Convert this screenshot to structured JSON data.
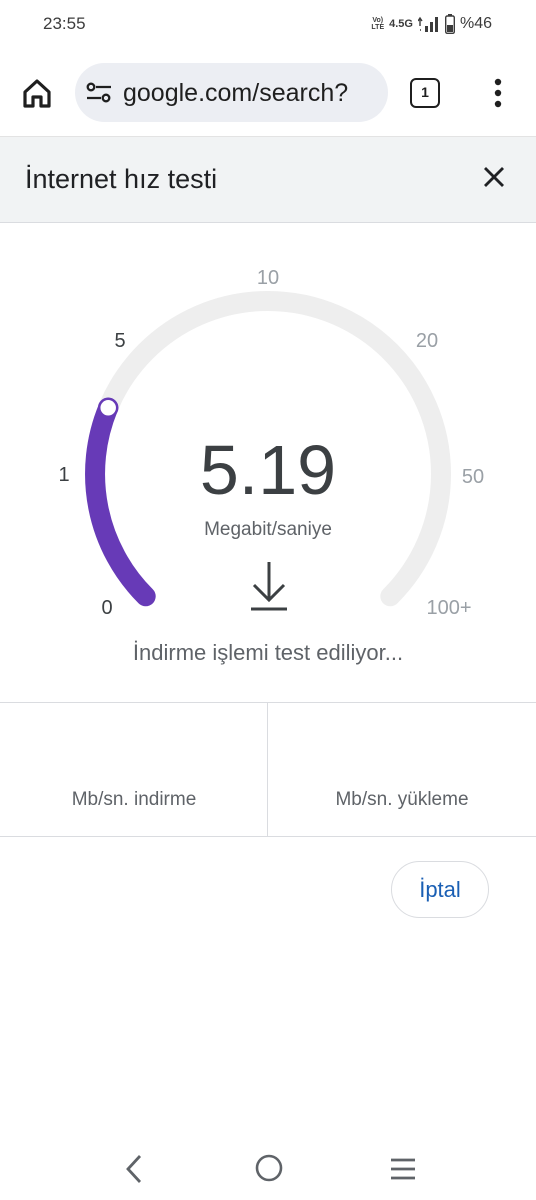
{
  "status_bar": {
    "time": "23:55",
    "volte_line1": "Vo)",
    "volte_line2": "LTE",
    "network": "4.5G",
    "battery": "%46"
  },
  "browser": {
    "url": "google.com/search?",
    "tab_count": "1"
  },
  "panel": {
    "title": "İnternet hız testi"
  },
  "gauge": {
    "ticks": [
      "0",
      "1",
      "5",
      "10",
      "20",
      "50",
      "100+"
    ],
    "value": "5.19",
    "unit": "Megabit/saniye",
    "progress_fraction": 0.25,
    "accent_color": "#673ab7",
    "track_color": "#eeeeee"
  },
  "status_message": "İndirme işlemi test ediliyor...",
  "results": {
    "download_label": "Mb/sn. indirme",
    "upload_label": "Mb/sn. yükleme"
  },
  "actions": {
    "cancel_label": "İptal"
  },
  "icons": {
    "home": "home-icon",
    "tune": "tune-icon",
    "tabs": "tab-switcher-icon",
    "menu": "more-vert-icon",
    "close": "close-icon",
    "download": "download-arrow-icon",
    "nav_back": "back-icon",
    "nav_home": "circle-home-icon",
    "nav_recent": "recent-apps-icon"
  }
}
